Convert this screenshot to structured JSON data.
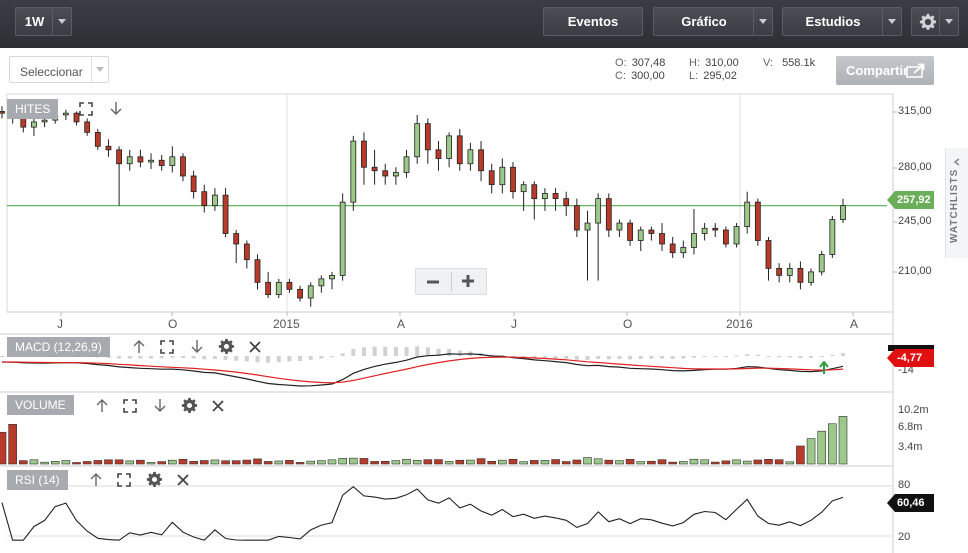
{
  "toolbar": {
    "interval": "1W",
    "eventos": "Eventos",
    "grafico": "Gráfico",
    "estudios": "Estudios"
  },
  "subbar": {
    "select_placeholder": "Seleccionar",
    "o_label": "O:",
    "o_value": "307,48",
    "c_label": "C:",
    "c_value": "300,00",
    "h_label": "H:",
    "h_value": "310,00",
    "l_label": "L:",
    "l_value": "295,02",
    "v_label": "V:",
    "v_value": "558.1k",
    "share": "Compartir"
  },
  "watchlists": "WATCHLISTS",
  "panels": {
    "price": {
      "label": "HITES",
      "last": "257,92",
      "yticks": [
        "315,00",
        "280,00",
        "245,00",
        "210,00"
      ]
    },
    "macd": {
      "label": "MACD (12,26,9)",
      "value": "-4,77",
      "ytick": "-14"
    },
    "volume": {
      "label": "VOLUME",
      "yticks": [
        "10.2m",
        "6.8m",
        "3.4m"
      ]
    },
    "rsi": {
      "label": "RSI (14)",
      "value": "60,46",
      "yticks": [
        "80",
        "20"
      ]
    }
  },
  "xaxis": [
    "J",
    "O",
    "2015",
    "A",
    "J",
    "O",
    "2016",
    "A"
  ],
  "colors": {
    "up": "#9cc88a",
    "down": "#b83a2a",
    "macd_line": "#222222",
    "signal_line": "#e02020",
    "level_line": "#3aa33a"
  },
  "chart_data": {
    "type": "candlestick",
    "last_price": 257.92,
    "ylim": [
      197,
      322
    ],
    "candles": [
      [
        312,
        315,
        308,
        311
      ],
      [
        311,
        314,
        305,
        308
      ],
      [
        308,
        310,
        300,
        303
      ],
      [
        303,
        308,
        298,
        306
      ],
      [
        306,
        310,
        303,
        307
      ],
      [
        307,
        312,
        305,
        310
      ],
      [
        310,
        313,
        307,
        311
      ],
      [
        311,
        312,
        304,
        306
      ],
      [
        306,
        308,
        298,
        300
      ],
      [
        300,
        302,
        290,
        292
      ],
      [
        292,
        296,
        286,
        290
      ],
      [
        290,
        292,
        258,
        282
      ],
      [
        282,
        290,
        278,
        286
      ],
      [
        286,
        290,
        280,
        283
      ],
      [
        283,
        288,
        279,
        284
      ],
      [
        284,
        287,
        278,
        281
      ],
      [
        281,
        292,
        277,
        286
      ],
      [
        286,
        288,
        272,
        275
      ],
      [
        275,
        278,
        262,
        266
      ],
      [
        266,
        270,
        254,
        258
      ],
      [
        258,
        268,
        255,
        264
      ],
      [
        264,
        268,
        240,
        242
      ],
      [
        242,
        244,
        225,
        236
      ],
      [
        236,
        238,
        222,
        227
      ],
      [
        227,
        230,
        210,
        214
      ],
      [
        214,
        220,
        205,
        207
      ],
      [
        207,
        216,
        205,
        214
      ],
      [
        214,
        216,
        208,
        210
      ],
      [
        210,
        212,
        203,
        205
      ],
      [
        205,
        214,
        200,
        212
      ],
      [
        212,
        218,
        208,
        216
      ],
      [
        216,
        220,
        210,
        218
      ],
      [
        218,
        265,
        215,
        260
      ],
      [
        260,
        298,
        255,
        295
      ],
      [
        295,
        300,
        270,
        280
      ],
      [
        280,
        290,
        270,
        278
      ],
      [
        278,
        282,
        270,
        275
      ],
      [
        275,
        280,
        270,
        277
      ],
      [
        277,
        290,
        274,
        286
      ],
      [
        286,
        310,
        282,
        305
      ],
      [
        305,
        308,
        282,
        290
      ],
      [
        290,
        295,
        278,
        285
      ],
      [
        285,
        300,
        280,
        298
      ],
      [
        298,
        302,
        278,
        282
      ],
      [
        282,
        294,
        278,
        290
      ],
      [
        290,
        295,
        272,
        278
      ],
      [
        278,
        282,
        265,
        270
      ],
      [
        270,
        285,
        265,
        280
      ],
      [
        280,
        283,
        262,
        266
      ],
      [
        266,
        272,
        255,
        270
      ],
      [
        270,
        272,
        250,
        262
      ],
      [
        262,
        268,
        255,
        265
      ],
      [
        265,
        268,
        255,
        262
      ],
      [
        262,
        266,
        252,
        258
      ],
      [
        258,
        262,
        240,
        244
      ],
      [
        244,
        255,
        215,
        248
      ],
      [
        248,
        265,
        215,
        262
      ],
      [
        262,
        265,
        240,
        244
      ],
      [
        244,
        250,
        240,
        248
      ],
      [
        248,
        250,
        235,
        238
      ],
      [
        238,
        246,
        232,
        244
      ],
      [
        244,
        246,
        238,
        242
      ],
      [
        242,
        248,
        232,
        236
      ],
      [
        236,
        240,
        228,
        231
      ],
      [
        231,
        238,
        228,
        234
      ],
      [
        234,
        256,
        230,
        242
      ],
      [
        242,
        248,
        238,
        245
      ],
      [
        245,
        248,
        240,
        244
      ],
      [
        244,
        246,
        234,
        236
      ],
      [
        236,
        248,
        234,
        246
      ],
      [
        246,
        266,
        242,
        260
      ],
      [
        260,
        262,
        235,
        238
      ],
      [
        238,
        240,
        215,
        222
      ],
      [
        222,
        225,
        214,
        218
      ],
      [
        218,
        225,
        214,
        222
      ],
      [
        222,
        226,
        210,
        214
      ],
      [
        214,
        222,
        212,
        220
      ],
      [
        220,
        232,
        218,
        230
      ],
      [
        230,
        252,
        228,
        250
      ],
      [
        250,
        262,
        248,
        258
      ]
    ],
    "macd_value": -4.77,
    "rsi_value": 60.46,
    "volume_ylim": [
      0,
      10.2
    ],
    "volume_units": "m"
  }
}
